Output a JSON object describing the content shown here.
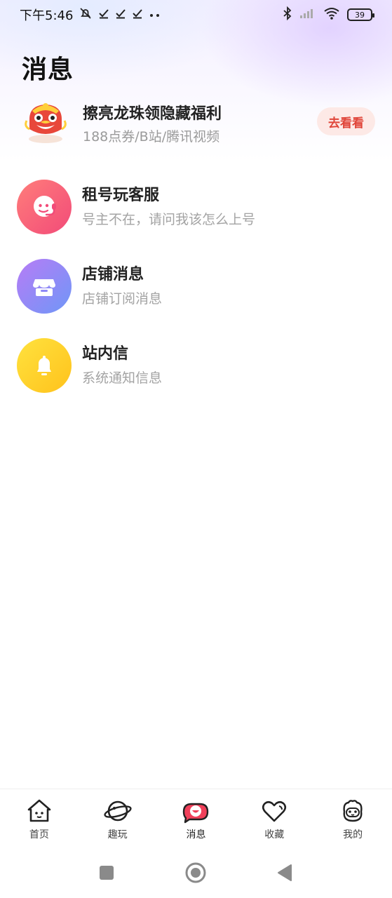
{
  "status_bar": {
    "time": "下午5:46",
    "battery": "39",
    "icons": [
      "mute-bell-icon",
      "check-icon",
      "check-icon",
      "check-icon",
      "more-dots-icon",
      "bluetooth-icon",
      "signal-icon",
      "wifi-icon",
      "battery-icon"
    ]
  },
  "page": {
    "title": "消息"
  },
  "promo": {
    "title": "擦亮龙珠领隐藏福利",
    "subtitle": "188点券/B站/腾讯视频",
    "button_label": "去看看",
    "icon": "lion-dance-icon"
  },
  "messages": [
    {
      "title": "租号玩客服",
      "subtitle": "号主不在，请问我该怎么上号",
      "icon": "customer-service-icon",
      "color": "#f4547a"
    },
    {
      "title": "店铺消息",
      "subtitle": "店铺订阅消息",
      "icon": "shop-icon",
      "color": "#8f89f7"
    },
    {
      "title": "站内信",
      "subtitle": "系统通知信息",
      "icon": "bell-icon",
      "color": "#ffcf25"
    }
  ],
  "tab_bar": {
    "tabs": [
      {
        "label": "首页",
        "icon": "home-icon"
      },
      {
        "label": "趣玩",
        "icon": "planet-icon"
      },
      {
        "label": "消息",
        "icon": "message-icon",
        "active": true
      },
      {
        "label": "收藏",
        "icon": "heart-icon"
      },
      {
        "label": "我的",
        "icon": "profile-icon"
      }
    ]
  },
  "nav_bar": {
    "icons": [
      "recent-apps-icon",
      "home-circle-icon",
      "back-icon"
    ]
  },
  "colors": {
    "accent": "#e0463a",
    "active_tab": "#f0405a",
    "subtext": "#a3a3a3"
  }
}
